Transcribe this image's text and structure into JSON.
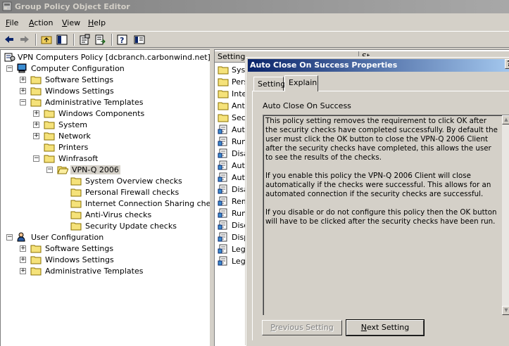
{
  "window": {
    "title": "Group Policy Object Editor",
    "title_icon": "gpo-editor-icon"
  },
  "menu": [
    {
      "label": "File",
      "accel": "F",
      "rest": "ile"
    },
    {
      "label": "Action",
      "accel": "A",
      "rest": "ction"
    },
    {
      "label": "View",
      "accel": "V",
      "rest": "iew"
    },
    {
      "label": "Help",
      "accel": "H",
      "rest": "elp"
    }
  ],
  "toolbar": {
    "buttons": [
      "back-icon",
      "forward-icon",
      "up-folder-icon",
      "show-hide-tree-icon",
      "properties-icon",
      "export-list-icon",
      "help-icon",
      "extended-view-icon"
    ]
  },
  "tree": {
    "root_label": "VPN Computers Policy [dcbranch.carbonwind.net] Policy",
    "computer_config": "Computer Configuration",
    "cc_software": "Software Settings",
    "cc_windows": "Windows Settings",
    "cc_admin": "Administrative Templates",
    "win_components": "Windows Components",
    "system": "System",
    "network": "Network",
    "printers": "Printers",
    "winfrasoft": "Winfrasoft",
    "vpnq": "VPN-Q 2006",
    "sys_overview": "System Overview checks",
    "personal_fw": "Personal Firewall checks",
    "ics": "Internet Connection Sharing checks",
    "antivirus": "Anti-Virus checks",
    "secupdate": "Security Update checks",
    "user_config": "User Configuration",
    "uc_software": "Software Settings",
    "uc_windows": "Windows Settings",
    "uc_admin": "Administrative Templates"
  },
  "list": {
    "header_setting": "Setting",
    "header_state": "St",
    "rows": [
      {
        "label": "Syste",
        "icon": "folder-icon"
      },
      {
        "label": "Perso",
        "icon": "folder-icon"
      },
      {
        "label": "Inter",
        "icon": "folder-icon"
      },
      {
        "label": "Anti-",
        "icon": "folder-icon"
      },
      {
        "label": "Secu",
        "icon": "folder-icon"
      },
      {
        "label": "Auto",
        "icon": "policy-setting-icon"
      },
      {
        "label": "Run",
        "icon": "policy-setting-icon"
      },
      {
        "label": "Disab",
        "icon": "policy-setting-icon"
      },
      {
        "label": "Auto",
        "icon": "policy-setting-icon"
      },
      {
        "label": "Auto",
        "icon": "policy-setting-icon"
      },
      {
        "label": "Disab",
        "icon": "policy-setting-icon"
      },
      {
        "label": "Remo",
        "icon": "policy-setting-icon"
      },
      {
        "label": "Run",
        "icon": "policy-setting-icon"
      },
      {
        "label": "Disco",
        "icon": "policy-setting-icon"
      },
      {
        "label": "Displ",
        "icon": "policy-setting-icon"
      },
      {
        "label": "Lega",
        "icon": "policy-setting-icon"
      },
      {
        "label": "Lega",
        "icon": "policy-setting-icon"
      }
    ]
  },
  "dialog": {
    "title": "Auto Close On Success Properties",
    "help": "?",
    "tabs": [
      "Setting",
      "Explain"
    ],
    "active_tab": "Explain",
    "policy_name": "Auto Close On Success",
    "explain": [
      "This policy setting removes the requirement to click OK after the security checks have completed successfully. By default the user must click the OK button to close the VPN-Q 2006 Client after the security checks have completed, this allows the user to see the results of the checks.",
      "If you enable this policy the VPN-Q 2006 Client will close automatically if the checks were successful. This allows for an automated connection if the security checks are successful.",
      "If you disable or do not configure this policy then the OK button will have to be clicked after the security checks have been run."
    ],
    "prev_accel": "P",
    "prev_rest": "revious Setting",
    "next_accel": "N",
    "next_rest": "ext Setting"
  }
}
